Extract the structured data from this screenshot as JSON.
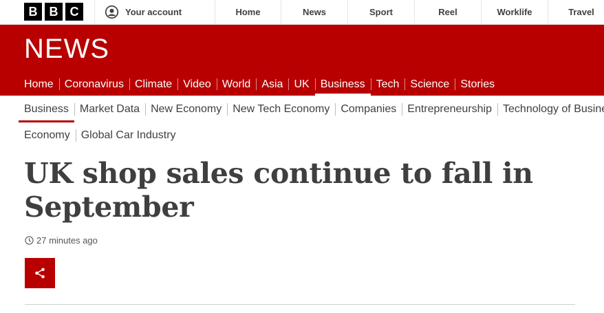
{
  "brand": {
    "letters": [
      "B",
      "B",
      "C"
    ],
    "news_logo": "NEWS",
    "accent_color": "#b80000"
  },
  "topbar": {
    "account_label": "Your account",
    "account_icon": "account-icon",
    "nav": [
      "Home",
      "News",
      "Sport",
      "Reel",
      "Worklife",
      "Travel"
    ]
  },
  "news_nav": {
    "items": [
      "Home",
      "Coronavirus",
      "Climate",
      "Video",
      "World",
      "Asia",
      "UK",
      "Business",
      "Tech",
      "Science",
      "Stories"
    ],
    "active": "Business"
  },
  "sub_nav": {
    "row1": [
      "Business",
      "Market Data",
      "New Economy",
      "New Tech Economy",
      "Companies",
      "Entrepreneurship",
      "Technology of Business"
    ],
    "row2": [
      "Economy",
      "Global Car Industry"
    ],
    "active": "Business"
  },
  "article": {
    "headline": "UK shop sales continue to fall in September",
    "timestamp": "27 minutes ago",
    "timestamp_icon": "clock-icon",
    "share_icon": "share-icon"
  }
}
